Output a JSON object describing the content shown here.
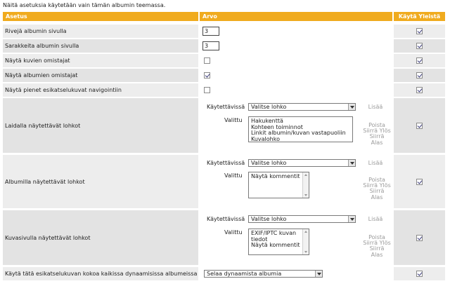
{
  "intro": "Näitä asetuksia käytetään vain tämän albumin teemassa.",
  "headers": {
    "setting": "Asetus",
    "value": "Arvo",
    "use_global": "Käytä Yleistä"
  },
  "rows": {
    "rows_per_page": {
      "label": "Rivejä albumin sivulla",
      "value": "3",
      "global": true
    },
    "cols_per_page": {
      "label": "Sarakkeita albumin sivulla",
      "value": "3",
      "global": true
    },
    "show_image_owners": {
      "label": "Näytä kuvien omistajat",
      "checked": false,
      "global": true
    },
    "show_album_owners": {
      "label": "Näytä albumien omistajat",
      "checked": true,
      "global": true
    },
    "show_small_thumbs": {
      "label": "Näytä pienet esikatselukuvat navigointiin",
      "checked": false,
      "global": true
    }
  },
  "block_ui": {
    "available_label": "Käytettävissä",
    "selected_label": "Valittu",
    "select_placeholder": "Valitse lohko",
    "add": "Lisää",
    "remove": "Poista",
    "move_up": "Siirrä Ylös",
    "move_down": "Siirrä Alas"
  },
  "sidebar_blocks": {
    "label": "Laidalla näytettävät lohkot",
    "selected": [
      "Hakukenttä",
      "Kohteen toiminnot",
      "Linkit albumin/kuvan vastapuoliin",
      "Kuvalohko"
    ],
    "global": true
  },
  "album_blocks": {
    "label": "Albumilla näytettävät lohkot",
    "selected": [
      "Näytä kommentit"
    ],
    "global": true
  },
  "image_blocks": {
    "label": "Kuvasivulla näytettävät lohkot",
    "selected": [
      "EXIF/IPTC kuvan tiedot",
      "Näytä kommentit"
    ],
    "global": true
  },
  "dynamic_thumb": {
    "label": "Käytä tätä esikatselukuvan kokoa kaikissa dynaamisissa albumeissa",
    "value": "Selaa dynaamista albumia",
    "global": true
  }
}
